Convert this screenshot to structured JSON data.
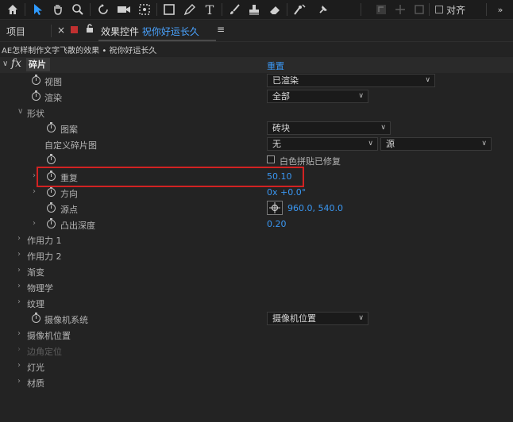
{
  "toolbar": {
    "tools": [
      "home-icon",
      "selection-arrow-icon",
      "hand-icon",
      "zoom-icon",
      "rotate-icon",
      "camera-icon",
      "pan-behind-icon",
      "rectangle-icon",
      "pen-icon",
      "type-icon",
      "brush-icon",
      "clone-stamp-icon",
      "eraser-icon",
      "roto-brush-icon",
      "puppet-pin-icon"
    ],
    "snap_label": "对齐"
  },
  "tabs": {
    "project": "项目",
    "close": "×",
    "effects_prefix": "效果控件",
    "comp_name": "祝你好运长久",
    "menu": "≡"
  },
  "breadcrumb": "AE怎样制作文字飞散的效果 • 祝你好运长久",
  "effect": {
    "fx": "fx",
    "name": "碎片",
    "reset": "重置"
  },
  "rows": {
    "view": {
      "label": "视图",
      "value": "已渲染"
    },
    "render": {
      "label": "渲染",
      "value": "全部"
    },
    "shape": {
      "label": "形状"
    },
    "pattern": {
      "label": "图案",
      "value": "砖块"
    },
    "custom_map": {
      "label": "自定义碎片图",
      "value": "无",
      "source": "源"
    },
    "white_tile": {
      "label": "白色拼贴已修复"
    },
    "repetitions": {
      "label": "重复",
      "value": "50.10"
    },
    "direction": {
      "label": "方向",
      "value": "0x +0.0°"
    },
    "origin": {
      "label": "源点",
      "value": "960.0, 540.0"
    },
    "extrusion": {
      "label": "凸出深度",
      "value": "0.20"
    },
    "force1": {
      "label": "作用力 1"
    },
    "force2": {
      "label": "作用力 2"
    },
    "gradient": {
      "label": "渐变"
    },
    "physics": {
      "label": "物理学"
    },
    "textures": {
      "label": "纹理"
    },
    "camera_system": {
      "label": "摄像机系统",
      "value": "摄像机位置"
    },
    "camera_position": {
      "label": "摄像机位置"
    },
    "corner_pins": {
      "label": "边角定位"
    },
    "lighting": {
      "label": "灯光"
    },
    "material": {
      "label": "材质"
    }
  }
}
